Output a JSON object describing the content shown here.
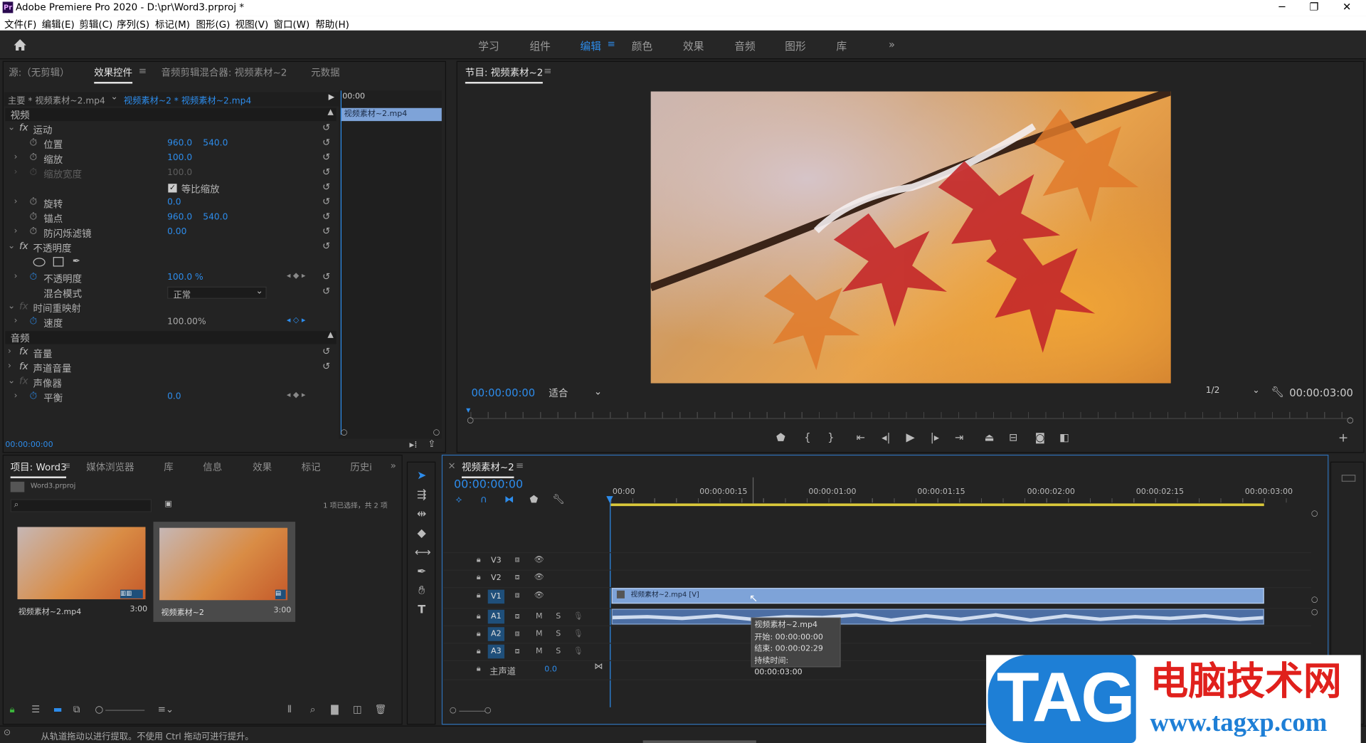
{
  "window": {
    "title": "Adobe Premiere Pro 2020 - D:\\pr\\Word3.prproj *",
    "logo": "Pr",
    "min": "─",
    "max": "❐",
    "close": "✕"
  },
  "menu": [
    "文件(F)",
    "编辑(E)",
    "剪辑(C)",
    "序列(S)",
    "标记(M)",
    "图形(G)",
    "视图(V)",
    "窗口(W)",
    "帮助(H)"
  ],
  "workspaces": {
    "items": [
      "学习",
      "组件",
      "编辑",
      "颜色",
      "效果",
      "音频",
      "图形",
      "库"
    ],
    "active": "编辑",
    "more": "»"
  },
  "source_panel": {
    "tabs": [
      "源:（无剪辑）",
      "效果控件",
      "音频剪辑混合器: 视频素材~2",
      "元数据"
    ],
    "active_tab": "效果控件",
    "master": "主要 * 视频素材~2.mp4",
    "sequence_clip": "视频素材~2 * 视频素材~2.mp4",
    "time_head": "00:00",
    "clip_bar": "视频素材~2.mp4",
    "video_label": "视频",
    "audio_label": "音频",
    "motion": "运动",
    "position": "位置",
    "position_x": "960.0",
    "position_y": "540.0",
    "scale": "缩放",
    "scale_v": "100.0",
    "scale_w": "缩放宽度",
    "scale_w_v": "100.0",
    "uniform": "等比缩放",
    "rotation": "旋转",
    "rotation_v": "0.0",
    "anchor": "锚点",
    "anchor_x": "960.0",
    "anchor_y": "540.0",
    "flicker": "防闪烁滤镜",
    "flicker_v": "0.00",
    "opacity": "不透明度",
    "opacity_prop": "不透明度",
    "opacity_v": "100.0 %",
    "blend": "混合模式",
    "blend_v": "正常",
    "time_remap": "时间重映射",
    "speed": "速度",
    "speed_v": "100.00%",
    "volume": "音量",
    "channel_volume": "声道音量",
    "panner": "声像器",
    "balance": "平衡",
    "balance_v": "0.0",
    "timecode": "00:00:00:00"
  },
  "program_monitor": {
    "title": "节目: 视频素材~2",
    "timecode": "00:00:00:00",
    "fit": "适合",
    "quality": "1/2",
    "duration": "00:00:03:00"
  },
  "project_panel": {
    "tabs": [
      "项目: Word3",
      "媒体浏览器",
      "库",
      "信息",
      "效果",
      "标记",
      "历史i"
    ],
    "active_tab": "项目: Word3",
    "file": "Word3.prproj",
    "selection": "1 项已选择，共 2 项",
    "items": [
      {
        "name": "视频素材~2.mp4",
        "duration": "3:00"
      },
      {
        "name": "视频素材~2",
        "duration": "3:00"
      }
    ]
  },
  "timeline": {
    "title": "视频素材~2",
    "timecode": "00:00:00:00",
    "ruler": [
      "00:00",
      "00:00:00:15",
      "00:00:01:00",
      "00:00:01:15",
      "00:00:02:00",
      "00:00:02:15",
      "00:00:03:00"
    ],
    "tracks": [
      "V3",
      "V2",
      "V1",
      "A1",
      "A2",
      "A3"
    ],
    "master": "主声道",
    "master_v": "0.0",
    "clip_label": "视频素材~2.mp4 [V]",
    "tooltip": {
      "name": "视频素材~2.mp4",
      "start": "开始: 00:00:00:00",
      "end": "结束: 00:00:02:29",
      "dur": "持续时间: 00:00:03:00"
    }
  },
  "status": "从轨道拖动以进行提取。不使用 Ctrl 拖动可进行提升。",
  "watermark": {
    "tag": "TAG",
    "cn": "电脑技术网",
    "url": "www.tagxp.com"
  },
  "colors": {
    "accent": "#2d8ceb",
    "clip_video": "#7ea3d8",
    "clip_audio": "#4c6ea3",
    "playhead": "#2d8ceb"
  }
}
